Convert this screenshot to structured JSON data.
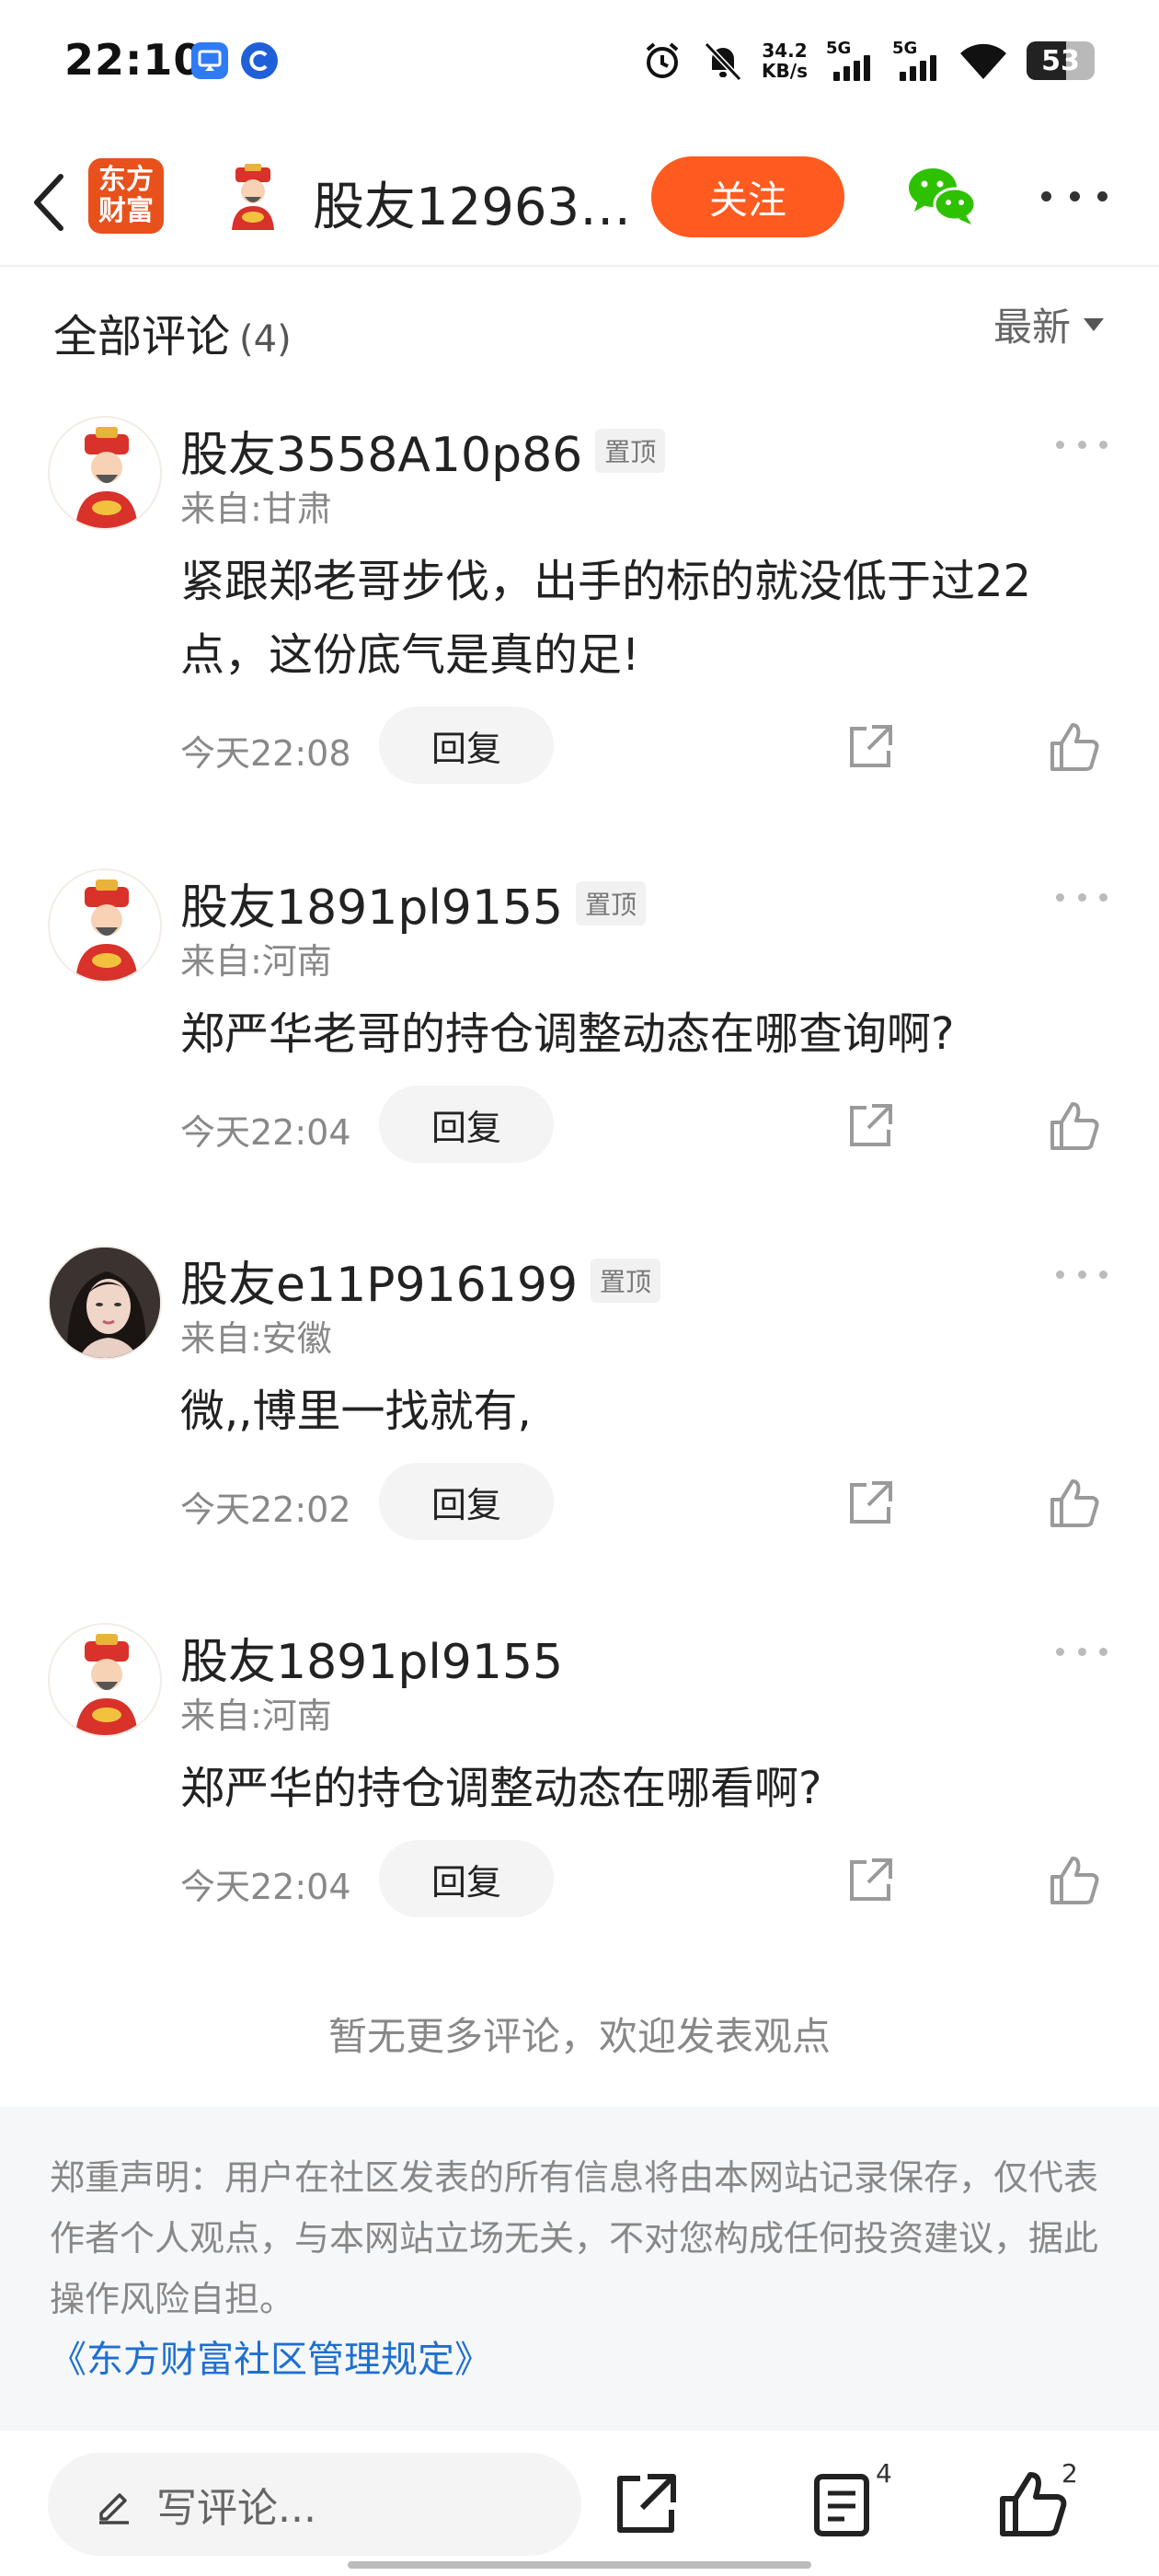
{
  "status_bar": {
    "time": "22:10",
    "net_speed_value": "34.2",
    "net_speed_unit": "KB/s",
    "sim1": "5G",
    "sim2": "5G",
    "battery": "53",
    "icons": [
      "screen-mirror-icon",
      "app-c-icon",
      "alarm-icon",
      "bell-off-icon",
      "signal-icon",
      "wifi-icon",
      "battery-icon"
    ]
  },
  "header": {
    "logo_line1": "东方",
    "logo_line2": "财富",
    "title": "股友12963…",
    "follow_label": "关注"
  },
  "comments_section": {
    "title": "全部评论",
    "count": "(4)",
    "sort_label": "最新"
  },
  "comments": [
    {
      "name": "股友3558A10p86",
      "badge": "置顶",
      "location": "来自:甘肃",
      "text": "紧跟郑老哥步伐，出手的标的就没低于过22点，这份底气是真的足!",
      "time": "今天22:08",
      "reply_label": "回复",
      "avatar": "fortune-god-avatar"
    },
    {
      "name": "股友1891pl9155",
      "badge": "置顶",
      "location": "来自:河南",
      "text": "郑严华老哥的持仓调整动态在哪查询啊?",
      "time": "今天22:04",
      "reply_label": "回复",
      "avatar": "fortune-god-avatar"
    },
    {
      "name": "股友e11P916199",
      "badge": "置顶",
      "location": "来自:安徽",
      "text": "微,,博里一找就有,",
      "time": "今天22:02",
      "reply_label": "回复",
      "avatar": "girl-photo-avatar"
    },
    {
      "name": "股友1891pl9155",
      "badge": "",
      "location": "来自:河南",
      "text": "郑严华的持仓调整动态在哪看啊?",
      "time": "今天22:04",
      "reply_label": "回复",
      "avatar": "fortune-god-avatar"
    }
  ],
  "no_more_text": "暂无更多评论，欢迎发表观点",
  "disclaimer": {
    "text": "郑重声明：用户在社区发表的所有信息将由本网站记录保存，仅代表作者个人观点，与本网站立场无关，不对您构成任何投资建议，据此操作风险自担。",
    "link": "《东方财富社区管理规定》"
  },
  "bottom_bar": {
    "input_placeholder": "写评论...",
    "comments_count": "4",
    "likes_count": "2"
  },
  "colors": {
    "accent": "#ff5a1f",
    "logo": "#e8501c",
    "link": "#1e6fd0",
    "wechat": "#2dc100"
  }
}
